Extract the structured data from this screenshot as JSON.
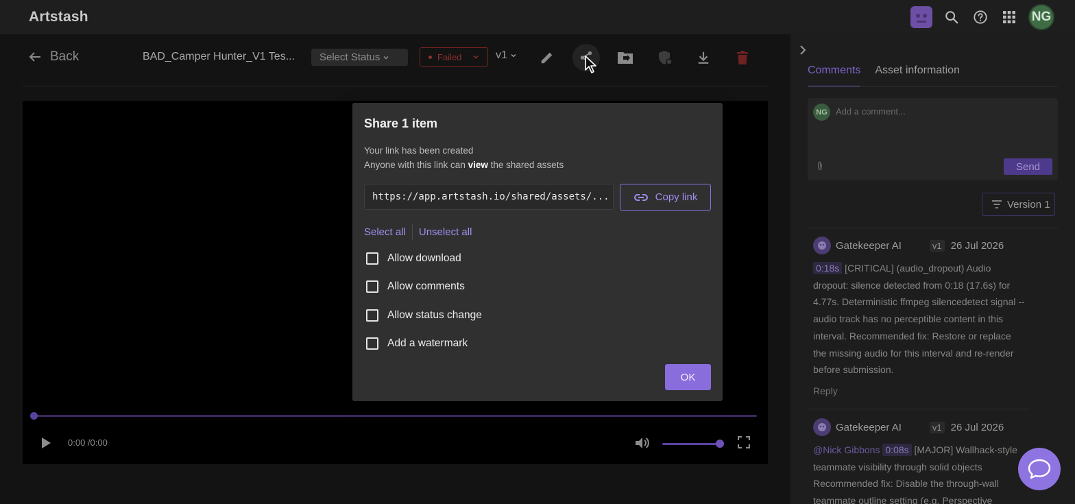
{
  "app": {
    "title": "Artstash",
    "user_initials": "NG"
  },
  "toolbar": {
    "back_label": "Back",
    "asset_name": "BAD_Camper Hunter_V1 Tes...",
    "status_placeholder": "Select Status",
    "failed_label": "Failed",
    "version_label": "v1"
  },
  "player": {
    "time": "0:00 /0:00",
    "progress": 0,
    "volume": 1.0
  },
  "panel": {
    "tabs": [
      {
        "label": "Comments",
        "active": true
      },
      {
        "label": "Asset information",
        "active": false
      }
    ],
    "comment_avatar": "NG",
    "comment_placeholder": "Add a comment...",
    "send_label": "Send",
    "version_filter": "Version 1",
    "comments": [
      {
        "author": "Gatekeeper AI",
        "version": "v1",
        "date": "26 Jul 2026",
        "mention": "",
        "timestamp": "0:18s",
        "text": "[CRITICAL] (audio_dropout) Audio dropout: silence detected from 0:18 (17.6s) for 4.77s. Deterministic ffmpeg silencedetect signal -- audio track has no perceptible content in this interval. Recommended fix: Restore or replace the missing audio for this interval and re-render before submission.",
        "reply_label": "Reply"
      },
      {
        "author": "Gatekeeper AI",
        "version": "v1",
        "date": "26 Jul 2026",
        "mention": "@Nick Gibbons",
        "timestamp": "0:08s",
        "text": "[MAJOR] Wallhack-style teammate visibility through solid objects Recommended fix: Disable the through-wall teammate outline setting (e.g. Perspective",
        "reply_label": ""
      }
    ]
  },
  "modal": {
    "title": "Share 1 item",
    "line1": "Your link has been created",
    "line2_prefix": "Anyone with this link can ",
    "line2_bold": "view",
    "line2_suffix": " the shared assets",
    "link": "https://app.artstash.io/shared/assets/...",
    "copy_label": "Copy link",
    "select_all": "Select all",
    "unselect_all": "Unselect all",
    "options": [
      {
        "label": "Allow download",
        "checked": false
      },
      {
        "label": "Allow comments",
        "checked": false
      },
      {
        "label": "Allow status change",
        "checked": false
      },
      {
        "label": "Add a watermark",
        "checked": false
      }
    ],
    "ok_label": "OK"
  },
  "colors": {
    "accent": "#8a6ddc",
    "failed": "#7a2424",
    "background": "#151515"
  },
  "icons": [
    "arrow-left-icon",
    "pencil-icon",
    "share-icon",
    "folder-move-icon",
    "shield-add-icon",
    "download-icon",
    "trash-icon",
    "search-icon",
    "help-icon",
    "apps-grid-icon",
    "chevron-right-icon",
    "paperclip-icon",
    "filter-icon",
    "play-icon",
    "volume-icon",
    "fullscreen-icon",
    "link-icon",
    "chat-icon"
  ]
}
